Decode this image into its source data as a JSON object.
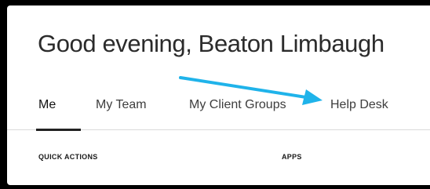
{
  "greeting": "Good evening, Beaton Limbaugh",
  "tabs": [
    {
      "label": "Me",
      "active": true
    },
    {
      "label": "My Team",
      "active": false
    },
    {
      "label": "My Client Groups",
      "active": false
    },
    {
      "label": "Help Desk",
      "active": false
    }
  ],
  "sections": {
    "quick_actions": "QUICK ACTIONS",
    "apps": "APPS"
  },
  "annotation": {
    "arrow_color": "#1fb3ea",
    "points_to": "Help Desk"
  },
  "colors": {
    "background": "#000000",
    "panel": "#ffffff",
    "active_indicator": "#222222"
  }
}
